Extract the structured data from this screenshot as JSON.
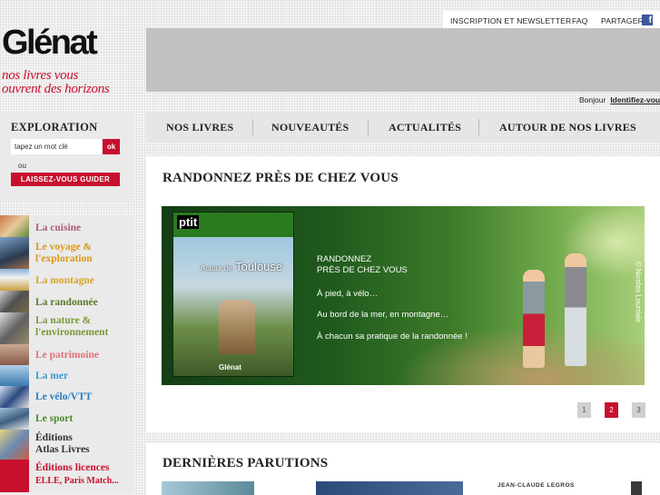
{
  "header": {
    "links": [
      "INSCRIPTION ET NEWSLETTER",
      "FAQ",
      "PARTAGER"
    ],
    "facebook_glyph": "f",
    "logo": "Glénat",
    "tagline_line1": "nos livres vous",
    "tagline_line2": "ouvrent des horizons",
    "greeting": "Bonjour",
    "login": "Identifiez-vous"
  },
  "exploration": {
    "title": "EXPLORATION",
    "search_placeholder": "tapez un mot clé",
    "ok": "ok",
    "or": "ou",
    "guide_button": "LAISSEZ-VOUS GUIDER"
  },
  "categories": [
    {
      "line1": "La cuisine",
      "line2": "",
      "color": "#b05a7a"
    },
    {
      "line1": "Le voyage &",
      "line2": "l'exploration",
      "color": "#d99a1a"
    },
    {
      "line1": "La montagne",
      "line2": "",
      "color": "#d9a428"
    },
    {
      "line1": "La randonnée",
      "line2": "",
      "color": "#5a7a2a"
    },
    {
      "line1": "La nature &",
      "line2": "l'environnement",
      "color": "#7a9a3a"
    },
    {
      "line1": "Le patrimoine",
      "line2": "",
      "color": "#e0707a"
    },
    {
      "line1": "La mer",
      "line2": "",
      "color": "#3a9ad0"
    },
    {
      "line1": "Le vélo/VTT",
      "line2": "",
      "color": "#2a7ac0"
    },
    {
      "line1": "Le sport",
      "line2": "",
      "color": "#4a8a2a"
    },
    {
      "line1": "Éditions",
      "line2": "Atlas Livres",
      "color": "#333333"
    },
    {
      "line1": "Éditions licences",
      "line2": "ELLE, Paris Match...",
      "color": "#c8102e"
    }
  ],
  "nav": [
    "NOS LIVRES",
    "NOUVEAUTÉS",
    "ACTUALITÉS",
    "AUTOUR DE NOS LIVRES"
  ],
  "feature": {
    "title": "RANDONNEZ PRÈS DE CHEZ VOUS",
    "book_series": "ptit",
    "book_title_prefix": "Autour de",
    "book_title": "Toulouse",
    "book_publisher": "Glénat",
    "headline1": "RANDONNEZ",
    "headline2": "PRÈS DE CHEZ VOUS",
    "line1": "À pied, à vélo…",
    "line2": "Au bord de la mer, en montagne…",
    "line3": "À chacun sa pratique de la randonnée !",
    "credit": "© Nicolas Lourdais",
    "pages": [
      "1",
      "2",
      "3"
    ],
    "current_page": "2"
  },
  "latest": {
    "title": "DERNIÈRES PARUTIONS",
    "author": "JEAN-CLAUDE LEGROS"
  },
  "colors": {
    "accent": "#c8102e",
    "facebook": "#3b5998"
  }
}
